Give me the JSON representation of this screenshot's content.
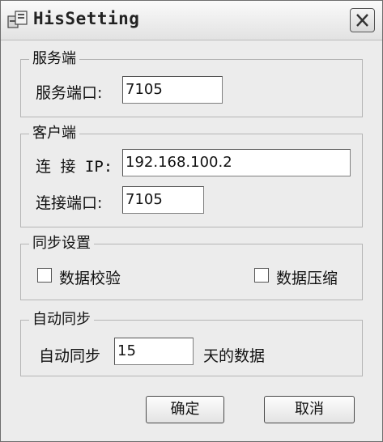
{
  "window": {
    "title": "HisSetting"
  },
  "server": {
    "group_label": "服务端",
    "port_label": "服务端口:",
    "port_value": "7105"
  },
  "client": {
    "group_label": "客户端",
    "ip_label": "连 接 IP:",
    "ip_value": "192.168.100.2",
    "port_label": "连接端口:",
    "port_value": "7105"
  },
  "sync_settings": {
    "group_label": "同步设置",
    "verify_label": "数据校验",
    "compress_label": "数据压缩"
  },
  "auto_sync": {
    "group_label": "自动同步",
    "prefix_label": "自动同步",
    "days_value": "15",
    "suffix_label": "天的数据"
  },
  "buttons": {
    "ok": "确定",
    "cancel": "取消"
  }
}
